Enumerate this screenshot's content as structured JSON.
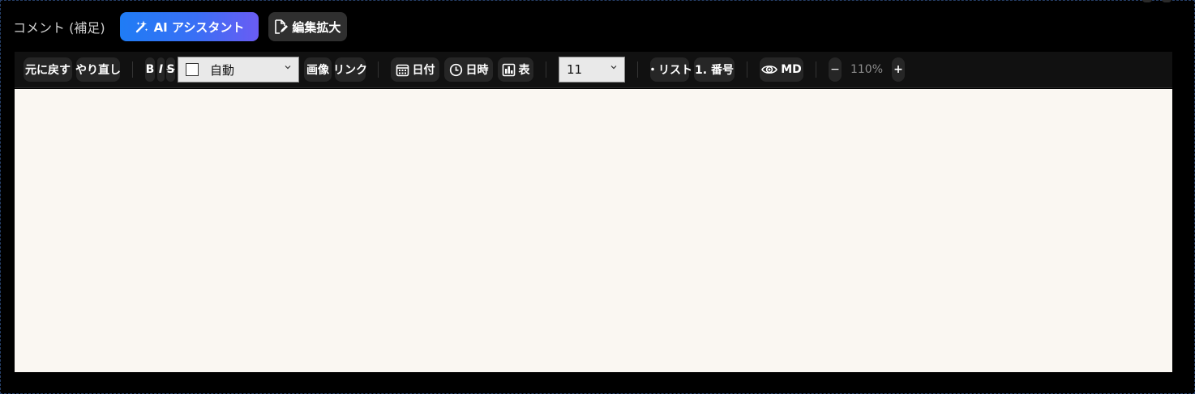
{
  "field": {
    "label": "コメント (補足)"
  },
  "header": {
    "ai_assistant_label": "AI アシスタント",
    "expand_label": "編集拡大"
  },
  "toolbar": {
    "undo_label": "元に戻す",
    "redo_label": "やり直し",
    "bold_label": "B",
    "italic_label": "I",
    "strike_label": "S",
    "color_select_value": "自動",
    "image_label": "画像",
    "link_label": "リンク",
    "date_label": "日付",
    "datetime_label": "日時",
    "table_label": "表",
    "font_size_value": "11",
    "bullet_list_label": "・リスト",
    "numbered_list_label": "1. 番号",
    "markdown_label": "MD",
    "zoom_out_label": "−",
    "zoom_value": "110%",
    "zoom_in_label": "+"
  },
  "editor": {
    "content": ""
  },
  "icons": {
    "ai": "magic-wand-icon",
    "expand": "edit-document-icon",
    "date": "calendar-icon",
    "datetime": "clock-icon",
    "table": "table-icon",
    "markdown": "eye-icon",
    "dropdown": "chevron-down-icon"
  },
  "colors": {
    "background": "#000000",
    "toolbar": "#111111",
    "button": "#262626",
    "editor": "#faf7f2",
    "ai_gradient_start": "#1f7cf5",
    "ai_gradient_end": "#6a5cf3"
  }
}
